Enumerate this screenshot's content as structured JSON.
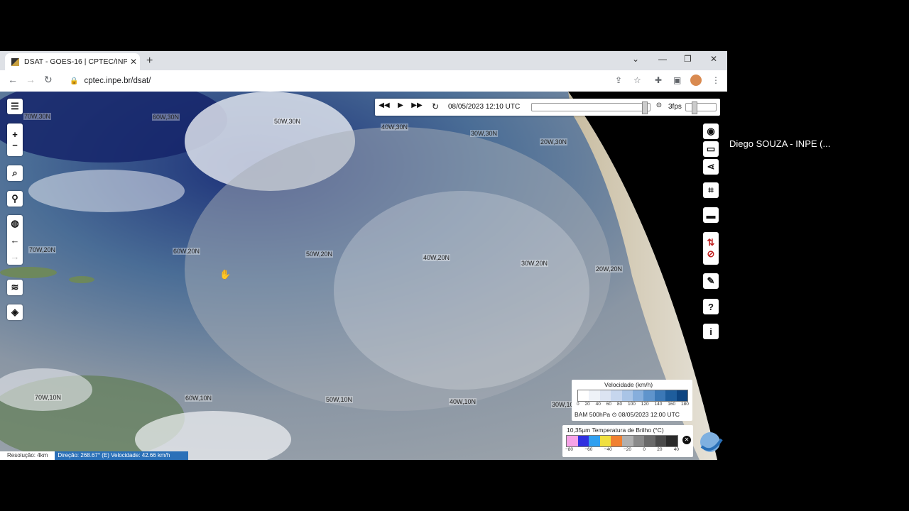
{
  "browser": {
    "tab_title": "DSAT - GOES-16 | CPTEC/INPE",
    "tab_close": "✕",
    "new_tab": "+",
    "url": "cptec.inpe.br/dsat/"
  },
  "player": {
    "datetime": "08/05/2023 12:10 UTC",
    "fps": "3fps",
    "timeline_position": 0.97
  },
  "map": {
    "grid_labels": [
      "70W,30N",
      "60W,30N",
      "50W,30N",
      "40W,30N",
      "30W,30N",
      "20W,30N",
      "70W,20N",
      "60W,20N",
      "50W,20N",
      "40W,20N",
      "30W,20N",
      "20W,20N",
      "70W,10N",
      "60W,10N",
      "50W,10N",
      "40W,10N",
      "30W,10N"
    ]
  },
  "legend_wind": {
    "title": "Velocidade (km/h)",
    "ticks": [
      "0",
      "20",
      "40",
      "60",
      "80",
      "100",
      "120",
      "140",
      "160",
      "180"
    ],
    "colors": [
      "#ffffff",
      "#eef2f8",
      "#dce4f2",
      "#c6d6ee",
      "#a9c4e6",
      "#86aedc",
      "#5f94cc",
      "#3b78b6",
      "#1e5d9c",
      "#0d4480"
    ],
    "caption": "BAM 500hPa ⊙ 08/05/2023 12:00 UTC"
  },
  "legend_temp": {
    "title": "10,35µm Temperatura de Brilho (°C)",
    "ticks": [
      "−80",
      "−60",
      "−40",
      "−20",
      "0",
      "20",
      "40"
    ],
    "colors": [
      "#f7a3e8",
      "#3030e0",
      "#30a0f0",
      "#f0e040",
      "#f08030",
      "#b0b0b0",
      "#8a8a8a",
      "#6a6a6a",
      "#4a4a4a",
      "#2a2a2a"
    ],
    "close": "✕"
  },
  "status": {
    "resolution": "Resolução: 4km",
    "direction": "Direção: 268.67° (E) Velocidade: 42.66 km/h"
  },
  "overlay": {
    "presenter": "Diego SOUZA - INPE (..."
  }
}
